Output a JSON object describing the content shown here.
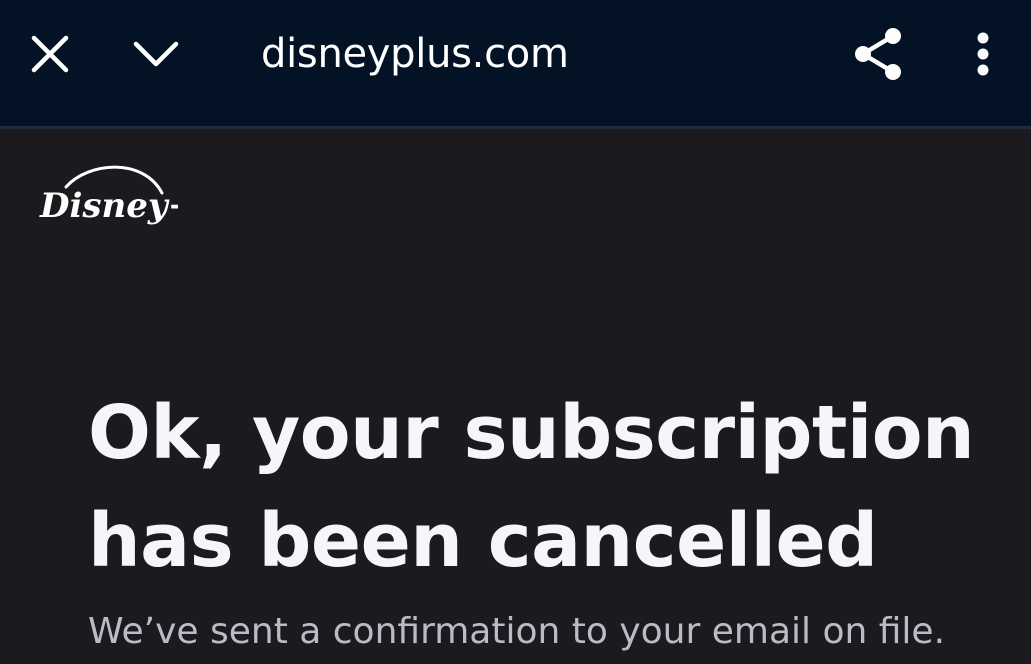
{
  "browser": {
    "url": "disneyplus.com",
    "icons": {
      "close": "close-icon",
      "collapse": "chevron-down-icon",
      "share": "share-icon",
      "menu": "more-vertical-icon"
    }
  },
  "page": {
    "logo": {
      "name": "disney-plus-logo",
      "text": "Disney+"
    },
    "headline": {
      "line1": "Ok, your subscription",
      "line2": "has been cancelled"
    },
    "subtext": "We’ve sent a confirmation to your email on file."
  },
  "colors": {
    "toolbar_background": "#031325",
    "page_background": "#1a1a1f",
    "text_primary": "#f6f6f8",
    "text_secondary": "#b9bcc6"
  }
}
